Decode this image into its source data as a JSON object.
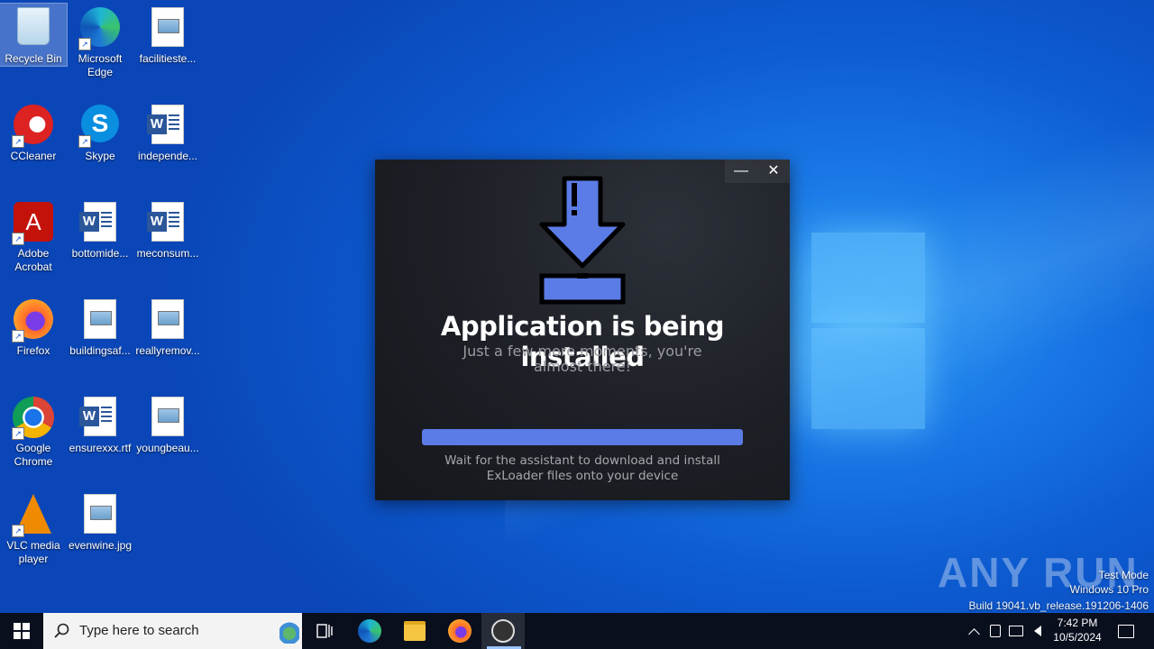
{
  "desktop": {
    "icons": [
      {
        "label": "Recycle Bin",
        "type": "recycle"
      },
      {
        "label": "Microsoft Edge",
        "type": "edge"
      },
      {
        "label": "facilitieste...",
        "type": "image-doc"
      },
      {
        "label": "CCleaner",
        "type": "ccleaner"
      },
      {
        "label": "Skype",
        "type": "skype"
      },
      {
        "label": "independe...",
        "type": "word-doc"
      },
      {
        "label": "Adobe Acrobat",
        "type": "acrobat"
      },
      {
        "label": "bottomide...",
        "type": "word-doc"
      },
      {
        "label": "meconsum...",
        "type": "word-doc"
      },
      {
        "label": "Firefox",
        "type": "firefox"
      },
      {
        "label": "buildingsaf...",
        "type": "image-doc"
      },
      {
        "label": "reallyremov...",
        "type": "image-doc"
      },
      {
        "label": "Google Chrome",
        "type": "chrome"
      },
      {
        "label": "ensurexxx.rtf",
        "type": "word-doc"
      },
      {
        "label": "youngbeau...",
        "type": "image-doc"
      },
      {
        "label": "VLC media player",
        "type": "vlc"
      },
      {
        "label": "evenwine.jpg",
        "type": "image-doc"
      }
    ]
  },
  "installer": {
    "minimize_glyph": "—",
    "close_glyph": "✕",
    "title": "Application is being installed",
    "subtitle": "Just a few more moments, you're almost there!",
    "progress": 1.0,
    "accent_color": "#5b7be6",
    "status": "Wait for the assistant to download and install ExLoader files onto your device"
  },
  "watermark": {
    "brand": "ANY RUN",
    "mode": "Test Mode",
    "edition": "Windows 10 Pro",
    "build": "Build 19041.vb_release.191206-1406"
  },
  "taskbar": {
    "search_placeholder": "Type here to search",
    "time": "7:42 PM",
    "date": "10/5/2024"
  }
}
